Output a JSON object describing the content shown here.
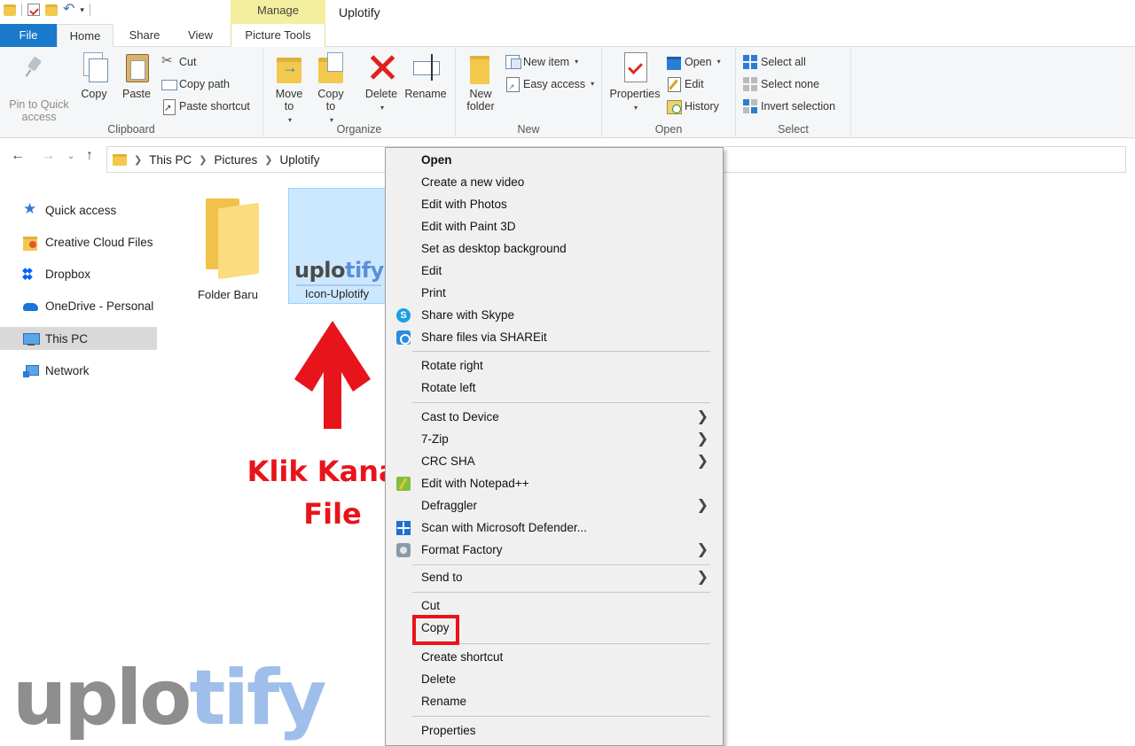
{
  "window": {
    "title": "Uplotify",
    "contextual_tab_group": "Manage"
  },
  "tabs": [
    {
      "label": "File"
    },
    {
      "label": "Home"
    },
    {
      "label": "Share"
    },
    {
      "label": "View"
    },
    {
      "label": "Picture Tools"
    }
  ],
  "ribbon": {
    "clipboard": {
      "label": "Clipboard",
      "pin_label": "Pin to Quick access",
      "copy_label": "Copy",
      "paste_label": "Paste",
      "cut_label": "Cut",
      "copy_path_label": "Copy path",
      "paste_shortcut_label": "Paste shortcut"
    },
    "organize": {
      "label": "Organize",
      "move_to_label": "Move to",
      "copy_to_label": "Copy to",
      "delete_label": "Delete",
      "rename_label": "Rename"
    },
    "new": {
      "label": "New",
      "new_folder_label": "New folder",
      "new_item_label": "New item",
      "easy_access_label": "Easy access"
    },
    "open": {
      "label": "Open",
      "properties_label": "Properties",
      "open_label": "Open",
      "edit_label": "Edit",
      "history_label": "History"
    },
    "select": {
      "label": "Select",
      "select_all_label": "Select all",
      "select_none_label": "Select none",
      "invert_selection_label": "Invert selection"
    }
  },
  "address": {
    "segments": [
      "This PC",
      "Pictures",
      "Uplotify"
    ]
  },
  "sidebar": {
    "items": [
      {
        "label": "Quick access",
        "icon": "star-icon"
      },
      {
        "label": "Creative Cloud Files",
        "icon": "creative-cloud-folder-icon"
      },
      {
        "label": "Dropbox",
        "icon": "dropbox-icon"
      },
      {
        "label": "OneDrive - Personal",
        "icon": "onedrive-cloud-icon"
      },
      {
        "label": "This PC",
        "icon": "computer-icon",
        "selected": true
      },
      {
        "label": "Network",
        "icon": "network-icon"
      }
    ]
  },
  "files": [
    {
      "name": "Folder Baru",
      "type": "folder"
    },
    {
      "name": "Icon-Uplotify",
      "type": "image",
      "selected": true,
      "thumbnail_text_a": "uplo",
      "thumbnail_text_b": "tify"
    }
  ],
  "annotation": {
    "line1": "Klik Kanan",
    "line2": "File",
    "color": "#e8141b"
  },
  "context_menu": {
    "items": [
      {
        "label": "Open",
        "bold": true
      },
      {
        "label": "Create a new video"
      },
      {
        "label": "Edit with Photos"
      },
      {
        "label": "Edit with Paint 3D"
      },
      {
        "label": "Set as desktop background"
      },
      {
        "label": "Edit"
      },
      {
        "label": "Print"
      },
      {
        "label": "Share with Skype",
        "icon": "skype-icon"
      },
      {
        "label": "Share files via SHAREit",
        "icon": "shareit-icon"
      },
      {
        "label": "Rotate right"
      },
      {
        "label": "Rotate left"
      },
      {
        "label": "Cast to Device",
        "submenu": true
      },
      {
        "label": "7-Zip",
        "submenu": true
      },
      {
        "label": "CRC SHA",
        "submenu": true
      },
      {
        "label": "Edit with Notepad++",
        "icon": "notepad-plus-plus-icon"
      },
      {
        "label": "Defraggler",
        "submenu": true
      },
      {
        "label": "Scan with Microsoft Defender...",
        "icon": "defender-icon"
      },
      {
        "label": "Format Factory",
        "icon": "format-factory-icon",
        "submenu": true
      },
      {
        "label": "Send to",
        "submenu": true
      },
      {
        "label": "Cut"
      },
      {
        "label": "Copy",
        "highlighted": true
      },
      {
        "label": "Create shortcut"
      },
      {
        "label": "Delete"
      },
      {
        "label": "Rename"
      },
      {
        "label": "Properties"
      }
    ]
  },
  "watermark": {
    "part_a": "uplo",
    "part_b": "tify"
  },
  "colors": {
    "accent": "#1979ca",
    "selection": "#cce8ff",
    "highlight": "#e8141b",
    "manage_tab": "#f4ef9e"
  }
}
